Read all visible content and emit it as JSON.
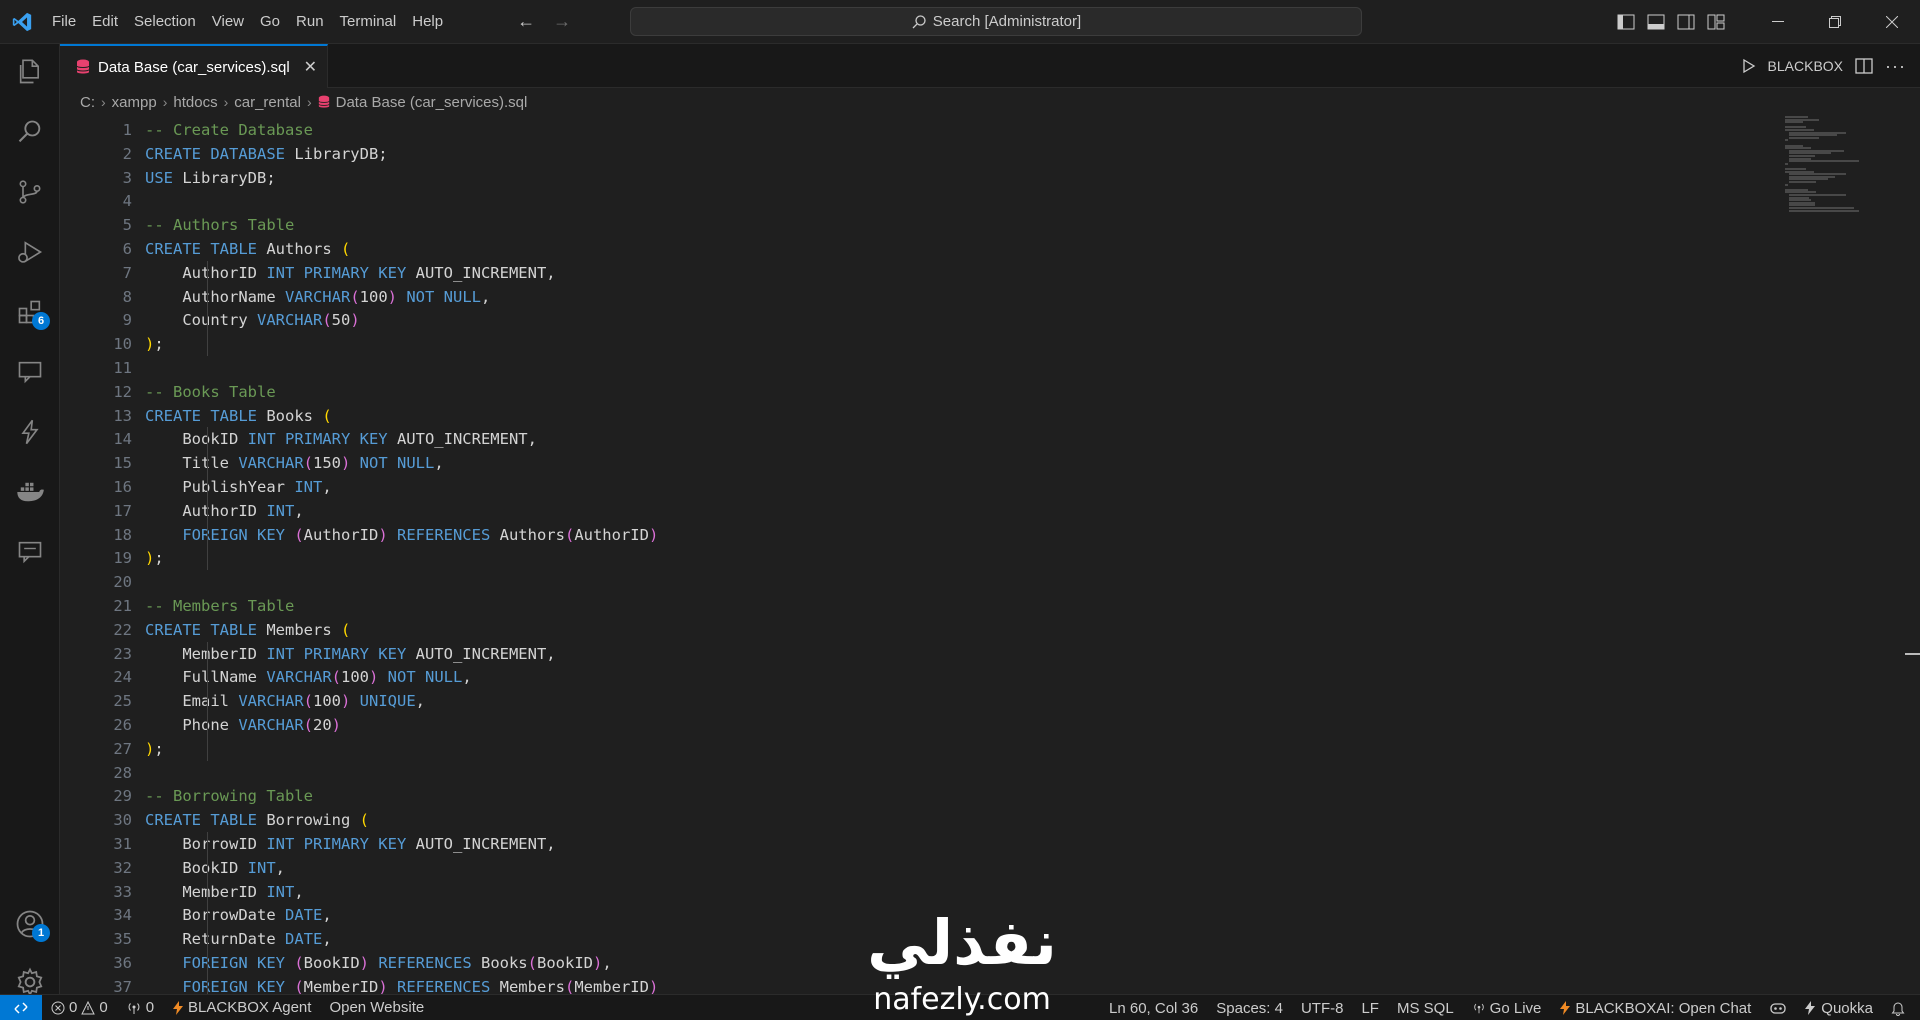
{
  "menu": [
    "File",
    "Edit",
    "Selection",
    "View",
    "Go",
    "Run",
    "Terminal",
    "Help"
  ],
  "search": {
    "label": "Search [Administrator]"
  },
  "activity_badges": {
    "extensions": "6",
    "accounts": "1"
  },
  "tab": {
    "label": "Data Base (car_services).sql",
    "close": "✕"
  },
  "tab_actions": {
    "blackbox": "BLACKBOX"
  },
  "breadcrumb": {
    "drive": "C:",
    "parts": [
      "xampp",
      "htdocs",
      "car_rental"
    ],
    "file": "Data Base (car_services).sql"
  },
  "code": [
    {
      "n": "1",
      "t": [
        [
          "cm",
          "-- Create Database"
        ]
      ]
    },
    {
      "n": "2",
      "t": [
        [
          "kw",
          "CREATE DATABASE "
        ],
        [
          "id",
          "LibraryDB;"
        ]
      ]
    },
    {
      "n": "3",
      "t": [
        [
          "kw",
          "USE "
        ],
        [
          "id",
          "LibraryDB;"
        ]
      ]
    },
    {
      "n": "4",
      "t": []
    },
    {
      "n": "5",
      "t": [
        [
          "cm",
          "-- Authors Table"
        ]
      ]
    },
    {
      "n": "6",
      "t": [
        [
          "kw",
          "CREATE TABLE "
        ],
        [
          "id",
          "Authors "
        ],
        [
          "p1",
          "("
        ]
      ]
    },
    {
      "n": "7",
      "t": [
        [
          "id",
          "    AuthorID "
        ],
        [
          "kw",
          "INT PRIMARY KEY "
        ],
        [
          "id",
          "AUTO_INCREMENT,"
        ]
      ]
    },
    {
      "n": "8",
      "t": [
        [
          "id",
          "    AuthorName "
        ],
        [
          "kw",
          "VARCHAR"
        ],
        [
          "p2",
          "("
        ],
        [
          "id",
          "100"
        ],
        [
          "p2",
          ")"
        ],
        [
          "kw",
          " NOT NULL"
        ],
        [
          "id",
          ","
        ]
      ]
    },
    {
      "n": "9",
      "t": [
        [
          "id",
          "    Country "
        ],
        [
          "kw",
          "VARCHAR"
        ],
        [
          "p2",
          "("
        ],
        [
          "id",
          "50"
        ],
        [
          "p2",
          ")"
        ]
      ]
    },
    {
      "n": "10",
      "t": [
        [
          "p1",
          ")"
        ],
        [
          "id",
          ";"
        ]
      ]
    },
    {
      "n": "11",
      "t": []
    },
    {
      "n": "12",
      "t": [
        [
          "cm",
          "-- Books Table"
        ]
      ]
    },
    {
      "n": "13",
      "t": [
        [
          "kw",
          "CREATE TABLE "
        ],
        [
          "id",
          "Books "
        ],
        [
          "p1",
          "("
        ]
      ]
    },
    {
      "n": "14",
      "t": [
        [
          "id",
          "    BookID "
        ],
        [
          "kw",
          "INT PRIMARY KEY "
        ],
        [
          "id",
          "AUTO_INCREMENT,"
        ]
      ]
    },
    {
      "n": "15",
      "t": [
        [
          "id",
          "    Title "
        ],
        [
          "kw",
          "VARCHAR"
        ],
        [
          "p2",
          "("
        ],
        [
          "id",
          "150"
        ],
        [
          "p2",
          ")"
        ],
        [
          "kw",
          " NOT NULL"
        ],
        [
          "id",
          ","
        ]
      ]
    },
    {
      "n": "16",
      "t": [
        [
          "id",
          "    PublishYear "
        ],
        [
          "kw",
          "INT"
        ],
        [
          "id",
          ","
        ]
      ]
    },
    {
      "n": "17",
      "t": [
        [
          "id",
          "    AuthorID "
        ],
        [
          "kw",
          "INT"
        ],
        [
          "id",
          ","
        ]
      ]
    },
    {
      "n": "18",
      "t": [
        [
          "kw",
          "    FOREIGN KEY "
        ],
        [
          "p2",
          "("
        ],
        [
          "id",
          "AuthorID"
        ],
        [
          "p2",
          ")"
        ],
        [
          "kw",
          " REFERENCES "
        ],
        [
          "id",
          "Authors"
        ],
        [
          "p2",
          "("
        ],
        [
          "id",
          "AuthorID"
        ],
        [
          "p2",
          ")"
        ]
      ]
    },
    {
      "n": "19",
      "t": [
        [
          "p1",
          ")"
        ],
        [
          "id",
          ";"
        ]
      ]
    },
    {
      "n": "20",
      "t": []
    },
    {
      "n": "21",
      "t": [
        [
          "cm",
          "-- Members Table"
        ]
      ]
    },
    {
      "n": "22",
      "t": [
        [
          "kw",
          "CREATE TABLE "
        ],
        [
          "id",
          "Members "
        ],
        [
          "p1",
          "("
        ]
      ]
    },
    {
      "n": "23",
      "t": [
        [
          "id",
          "    MemberID "
        ],
        [
          "kw",
          "INT PRIMARY KEY "
        ],
        [
          "id",
          "AUTO_INCREMENT,"
        ]
      ]
    },
    {
      "n": "24",
      "t": [
        [
          "id",
          "    FullName "
        ],
        [
          "kw",
          "VARCHAR"
        ],
        [
          "p2",
          "("
        ],
        [
          "id",
          "100"
        ],
        [
          "p2",
          ")"
        ],
        [
          "kw",
          " NOT NULL"
        ],
        [
          "id",
          ","
        ]
      ]
    },
    {
      "n": "25",
      "t": [
        [
          "id",
          "    Email "
        ],
        [
          "kw",
          "VARCHAR"
        ],
        [
          "p2",
          "("
        ],
        [
          "id",
          "100"
        ],
        [
          "p2",
          ")"
        ],
        [
          "kw",
          " UNIQUE"
        ],
        [
          "id",
          ","
        ]
      ]
    },
    {
      "n": "26",
      "t": [
        [
          "id",
          "    Phone "
        ],
        [
          "kw",
          "VARCHAR"
        ],
        [
          "p2",
          "("
        ],
        [
          "id",
          "20"
        ],
        [
          "p2",
          ")"
        ]
      ]
    },
    {
      "n": "27",
      "t": [
        [
          "p1",
          ")"
        ],
        [
          "id",
          ";"
        ]
      ]
    },
    {
      "n": "28",
      "t": []
    },
    {
      "n": "29",
      "t": [
        [
          "cm",
          "-- Borrowing Table"
        ]
      ]
    },
    {
      "n": "30",
      "t": [
        [
          "kw",
          "CREATE TABLE "
        ],
        [
          "id",
          "Borrowing "
        ],
        [
          "p1",
          "("
        ]
      ]
    },
    {
      "n": "31",
      "t": [
        [
          "id",
          "    BorrowID "
        ],
        [
          "kw",
          "INT PRIMARY KEY "
        ],
        [
          "id",
          "AUTO_INCREMENT,"
        ]
      ]
    },
    {
      "n": "32",
      "t": [
        [
          "id",
          "    BookID "
        ],
        [
          "kw",
          "INT"
        ],
        [
          "id",
          ","
        ]
      ]
    },
    {
      "n": "33",
      "t": [
        [
          "id",
          "    MemberID "
        ],
        [
          "kw",
          "INT"
        ],
        [
          "id",
          ","
        ]
      ]
    },
    {
      "n": "34",
      "t": [
        [
          "id",
          "    BorrowDate "
        ],
        [
          "kw",
          "DATE"
        ],
        [
          "id",
          ","
        ]
      ]
    },
    {
      "n": "35",
      "t": [
        [
          "id",
          "    ReturnDate "
        ],
        [
          "kw",
          "DATE"
        ],
        [
          "id",
          ","
        ]
      ]
    },
    {
      "n": "36",
      "t": [
        [
          "kw",
          "    FOREIGN KEY "
        ],
        [
          "p2",
          "("
        ],
        [
          "id",
          "BookID"
        ],
        [
          "p2",
          ")"
        ],
        [
          "kw",
          " REFERENCES "
        ],
        [
          "id",
          "Books"
        ],
        [
          "p2",
          "("
        ],
        [
          "id",
          "BookID"
        ],
        [
          "p2",
          ")"
        ],
        [
          "id",
          ","
        ]
      ]
    },
    {
      "n": "37",
      "t": [
        [
          "kw",
          "    FOREIGN KEY "
        ],
        [
          "p2",
          "("
        ],
        [
          "id",
          "MemberID"
        ],
        [
          "p2",
          ")"
        ],
        [
          "kw",
          " REFERENCES "
        ],
        [
          "id",
          "Members"
        ],
        [
          "p2",
          "("
        ],
        [
          "id",
          "MemberID"
        ],
        [
          "p2",
          ")"
        ]
      ]
    }
  ],
  "status": {
    "errors": "0",
    "warnings": "0",
    "ports": "0",
    "blackbox_agent": "BLACKBOX Agent",
    "open_website": "Open Website",
    "position": "Ln 60, Col 36",
    "spaces": "Spaces: 4",
    "encoding": "UTF-8",
    "eol": "LF",
    "language": "MS SQL",
    "go_live": "Go Live",
    "blackbox_chat": "BLACKBOXAI: Open Chat",
    "quokka": "Quokka"
  },
  "watermark": {
    "arabic": "نفذلي",
    "latin": "nafezly.com"
  },
  "colors": {
    "accent": "#0078d4",
    "keyword": "#569cd6",
    "comment": "#6a9955",
    "bracket1": "#ffd700",
    "bracket2": "#da70d6"
  }
}
